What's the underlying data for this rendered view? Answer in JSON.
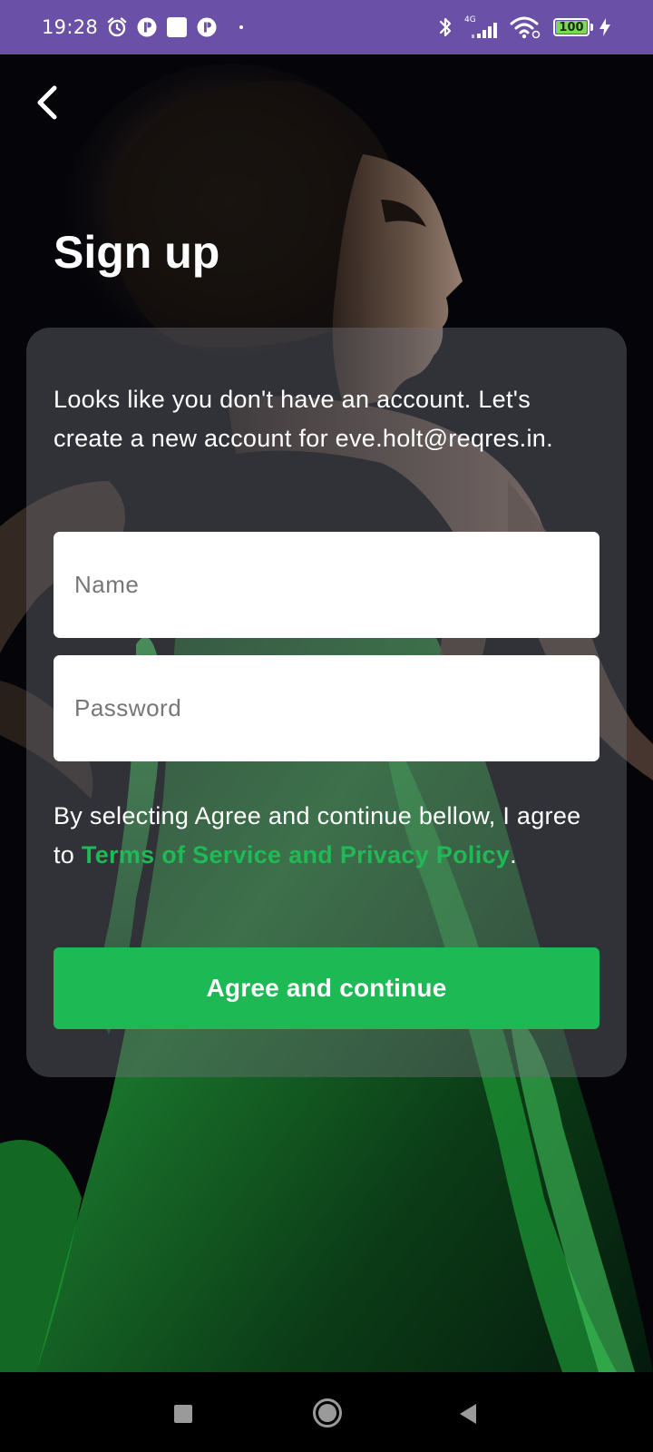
{
  "status_bar": {
    "time": "19:28",
    "network_label": "4G",
    "battery_level": "100",
    "battery_fraction": 1.0,
    "icons": [
      "alarm-icon",
      "app-notification-icon",
      "square-notification-icon",
      "app-notification-icon",
      "bluetooth-icon",
      "cellular-signal-icon",
      "wifi-icon",
      "battery-icon",
      "charging-icon"
    ]
  },
  "header": {
    "back_icon": "chevron-left-icon",
    "title": "Sign up"
  },
  "form": {
    "intro": "Looks like you don't have an account. Let's create a new account for eve.holt@reqres.in.",
    "name_field": {
      "placeholder": "Name",
      "value": ""
    },
    "password_field": {
      "placeholder": "Password",
      "value": ""
    },
    "terms_prefix": "By selecting Agree and continue bellow, I agree to ",
    "terms_link": "Terms of Service and Privacy Policy",
    "terms_suffix": ".",
    "submit_label": "Agree and continue"
  },
  "colors": {
    "status_bar": "#6a50a7",
    "accent_green": "#1db954",
    "link_green": "#1fb955",
    "card_overlay": "rgba(112,112,122,0.42)"
  },
  "nav_bar": {
    "buttons": [
      "recents-icon",
      "home-icon",
      "back-triangle-icon"
    ]
  }
}
